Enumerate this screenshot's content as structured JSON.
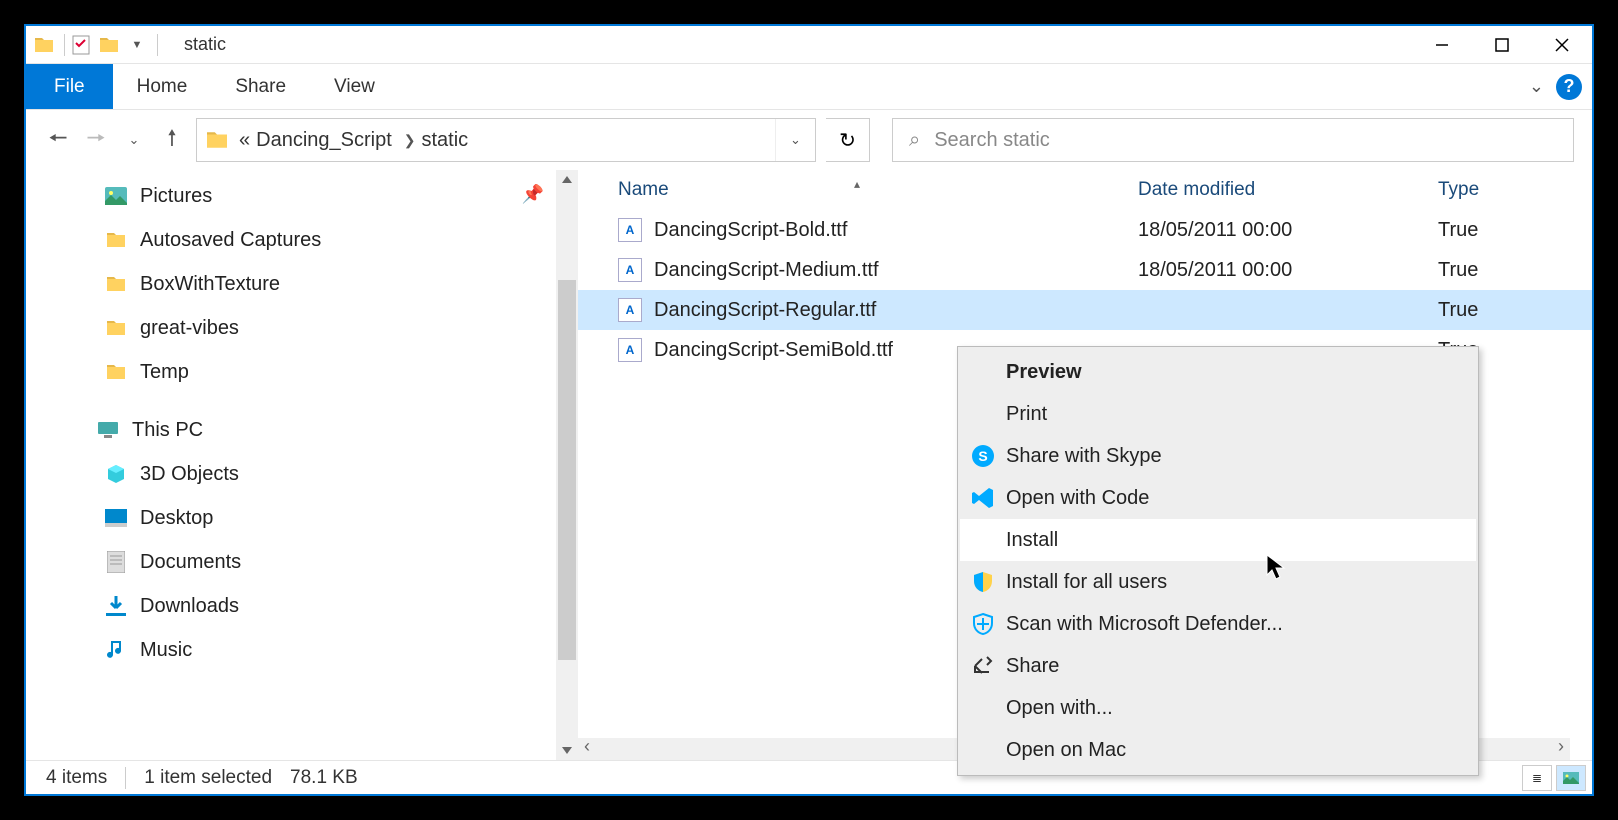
{
  "window_title": "static",
  "ribbon": {
    "file": "File",
    "tabs": [
      "Home",
      "Share",
      "View"
    ]
  },
  "breadcrumbs": {
    "prefix": "«",
    "parts": [
      "Dancing_Script",
      "static"
    ]
  },
  "search": {
    "placeholder": "Search static"
  },
  "nav": {
    "items": [
      {
        "label": "Pictures",
        "icon": "pictures",
        "pinned": true
      },
      {
        "label": "Autosaved Captures",
        "icon": "folder"
      },
      {
        "label": "BoxWithTexture",
        "icon": "folder"
      },
      {
        "label": "great-vibes",
        "icon": "folder"
      },
      {
        "label": "Temp",
        "icon": "folder"
      }
    ],
    "thispc": {
      "label": "This PC"
    },
    "pc_items": [
      {
        "label": "3D Objects",
        "icon": "3d"
      },
      {
        "label": "Desktop",
        "icon": "desktop"
      },
      {
        "label": "Documents",
        "icon": "documents"
      },
      {
        "label": "Downloads",
        "icon": "downloads"
      },
      {
        "label": "Music",
        "icon": "music"
      }
    ]
  },
  "columns": {
    "name": "Name",
    "date": "Date modified",
    "type": "Type"
  },
  "files": [
    {
      "name": "DancingScript-Bold.ttf",
      "date": "18/05/2011 00:00",
      "type": "True",
      "selected": false
    },
    {
      "name": "DancingScript-Medium.ttf",
      "date": "18/05/2011 00:00",
      "type": "True",
      "selected": false
    },
    {
      "name": "DancingScript-Regular.ttf",
      "date": "",
      "type": "True",
      "selected": true
    },
    {
      "name": "DancingScript-SemiBold.ttf",
      "date": "",
      "type": "True",
      "selected": false
    }
  ],
  "context_menu": {
    "items": [
      {
        "label": "Preview",
        "bold": true
      },
      {
        "label": "Print"
      },
      {
        "label": "Share with Skype",
        "icon": "skype"
      },
      {
        "label": "Open with Code",
        "icon": "vscode"
      },
      {
        "label": "Install",
        "hover": true
      },
      {
        "label": "Install for all users",
        "icon": "shield"
      },
      {
        "label": "Scan with Microsoft Defender...",
        "icon": "defender"
      },
      {
        "label": "Share",
        "icon": "share"
      },
      {
        "label": "Open with..."
      },
      {
        "label": "Open on Mac"
      }
    ]
  },
  "status": {
    "count": "4 items",
    "selection": "1 item selected",
    "size": "78.1 KB"
  }
}
